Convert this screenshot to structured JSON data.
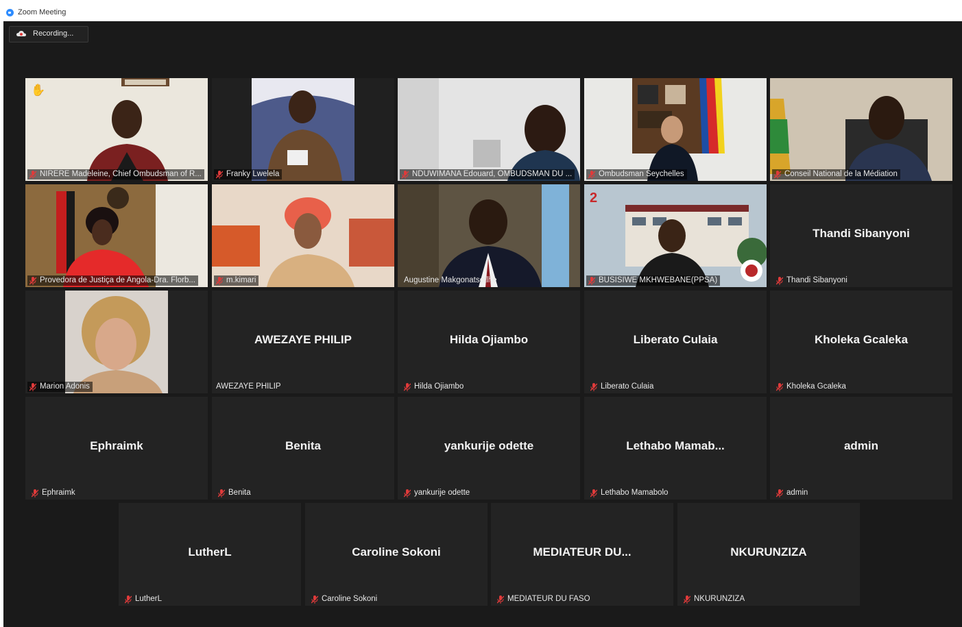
{
  "window": {
    "title": "Zoom Meeting"
  },
  "recording": {
    "label": "Recording..."
  },
  "tiles": [
    {
      "label": "NIRERE Madeleine, Chief Ombudsman of R...",
      "big": "",
      "video": true,
      "hand": "✋"
    },
    {
      "label": "Franky Lwelela",
      "big": "",
      "video": true
    },
    {
      "label": "NDUWIMANA Edouard, OMBUDSMAN DU ...",
      "big": "",
      "video": true
    },
    {
      "label": "Ombudsman Seychelles",
      "big": "",
      "video": true
    },
    {
      "label": "Conseil National de la Médiation",
      "big": "",
      "video": true
    },
    {
      "label": "Provedora  de Justiça de Angola-Dra. Florb...",
      "big": "",
      "video": true
    },
    {
      "label": "m.kimari",
      "big": "",
      "video": true
    },
    {
      "label": "Augustine Makgonatsotlhe",
      "big": "",
      "video": true,
      "active": true
    },
    {
      "label": "BUSISIWE MKHWEBANE(PPSA)",
      "big": "",
      "video": true
    },
    {
      "label": "Thandi Sibanyoni",
      "big": "Thandi Sibanyoni"
    },
    {
      "label": "Marion Adonis",
      "big": "",
      "video": true
    },
    {
      "label": "AWEZAYE PHILIP",
      "big": "AWEZAYE PHILIP",
      "nomute": true
    },
    {
      "label": "Hilda Ojiambo",
      "big": "Hilda Ojiambo"
    },
    {
      "label": "Liberato Culaia",
      "big": "Liberato Culaia"
    },
    {
      "label": "Kholeka Gcaleka",
      "big": "Kholeka Gcaleka"
    },
    {
      "label": "Ephraimk",
      "big": "Ephraimk"
    },
    {
      "label": "Benita",
      "big": "Benita"
    },
    {
      "label": "yankurije odette",
      "big": "yankurije odette"
    },
    {
      "label": "Lethabo Mamabolo",
      "big": "Lethabo  Mamab..."
    },
    {
      "label": "admin",
      "big": "admin"
    },
    {
      "label": "LutherL",
      "big": "LutherL"
    },
    {
      "label": "Caroline Sokoni",
      "big": "Caroline Sokoni"
    },
    {
      "label": "MEDIATEUR DU FASO",
      "big": "MEDIATEUR  DU..."
    },
    {
      "label": "NKURUNZIZA",
      "big": "NKURUNZIZA"
    }
  ],
  "colors": {
    "active_border": "#c8d84a",
    "muted_mic": "#e03a3a",
    "tile_bg": "#232323",
    "stage_bg": "#1a1a1a"
  }
}
